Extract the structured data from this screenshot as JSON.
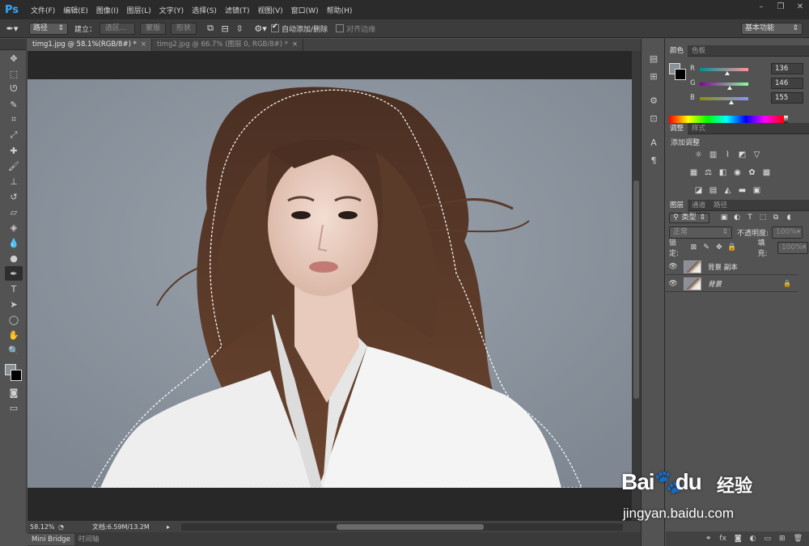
{
  "app": {
    "logo": "Ps"
  },
  "menu": [
    "文件(F)",
    "编辑(E)",
    "图像(I)",
    "图层(L)",
    "文字(Y)",
    "选择(S)",
    "滤镜(T)",
    "视图(V)",
    "窗口(W)",
    "帮助(H)"
  ],
  "options": {
    "tool_icon": "pen-tool-icon",
    "mode": "路径",
    "build_label": "建立：",
    "selection_btn": "选区...",
    "mask_btn": "蒙版",
    "shape_btn": "形状",
    "auto_add_delete": "自动添加/删除",
    "auto_add_delete_checked": true,
    "align_edges": "对齐边缘",
    "align_edges_checked": false,
    "workspace": "基本功能"
  },
  "tabs": [
    {
      "label": "timg1.jpg @ 58.1%(RGB/8#) *",
      "active": true
    },
    {
      "label": "timg2.jpg @ 66.7% (图层 0, RGB/8#) *",
      "active": false
    }
  ],
  "status": {
    "zoom": "58.12%",
    "doc": "文档:6.59M/13.2M"
  },
  "bottom_tabs": [
    "Mini Bridge",
    "时间轴"
  ],
  "color_panel": {
    "tabs": [
      "颜色",
      "色板"
    ],
    "r": {
      "label": "R",
      "value": "136"
    },
    "g": {
      "label": "G",
      "value": "146"
    },
    "b": {
      "label": "B",
      "value": "155"
    },
    "foreground": "#889296",
    "background": "#000000"
  },
  "adjust_panel": {
    "tabs": [
      "调整",
      "样式"
    ],
    "title": "添加调整"
  },
  "layers_panel": {
    "tabs": [
      "图层",
      "通道",
      "路径"
    ],
    "filter": "类型",
    "blend": "正常",
    "opacity_label": "不透明度:",
    "opacity": "100%",
    "lock_label": "锁定:",
    "fill_label": "填充:",
    "fill": "100%",
    "layers": [
      {
        "name": "背景 副本",
        "locked": false,
        "italic": false
      },
      {
        "name": "背景",
        "locked": true,
        "italic": true
      }
    ]
  },
  "watermark": {
    "brand": "Bai",
    "brand2": "du",
    "cn": "经验",
    "url": "jingyan.baidu.com"
  }
}
